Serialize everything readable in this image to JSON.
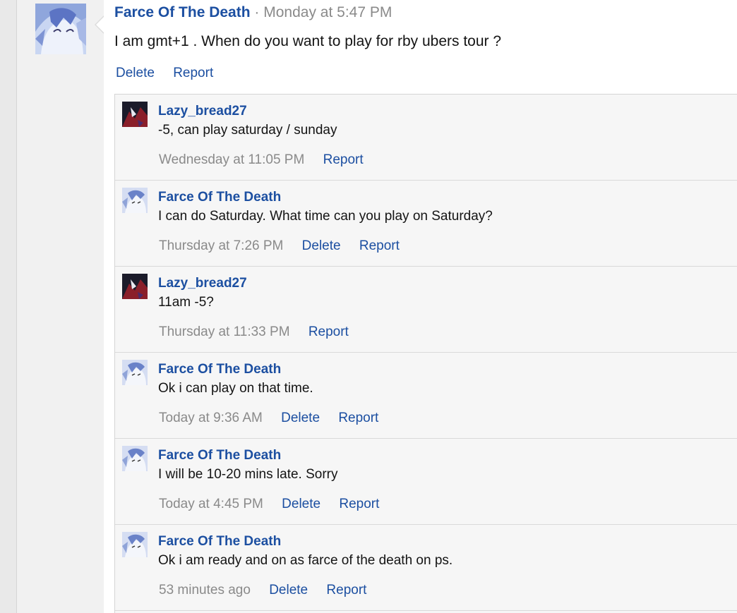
{
  "main_post": {
    "author": "Farce Of The Death",
    "separator": "·",
    "timestamp": "Monday at 5:47 PM",
    "message": "I am gmt+1 . When do you want to play for rby ubers tour ?",
    "actions": {
      "delete": "Delete",
      "report": "Report"
    }
  },
  "comments": [
    {
      "author": "Lazy_bread27",
      "text": "-5, can play saturday / sunday",
      "time": "Wednesday at 11:05 PM",
      "delete": "",
      "report": "Report",
      "avatar": "dark"
    },
    {
      "author": "Farce Of The Death",
      "text": "I can do Saturday. What time can you play on Saturday?",
      "time": "Thursday at 7:26 PM",
      "delete": "Delete",
      "report": "Report",
      "avatar": "light"
    },
    {
      "author": "Lazy_bread27",
      "text": "11am -5?",
      "time": "Thursday at 11:33 PM",
      "delete": "",
      "report": "Report",
      "avatar": "dark"
    },
    {
      "author": "Farce Of The Death",
      "text": "Ok i can play on that time.",
      "time": "Today at 9:36 AM",
      "delete": "Delete",
      "report": "Report",
      "avatar": "light"
    },
    {
      "author": "Farce Of The Death",
      "text": "I will be 10-20 mins late. Sorry",
      "time": "Today at 4:45 PM",
      "delete": "Delete",
      "report": "Report",
      "avatar": "light"
    },
    {
      "author": "Farce Of The Death",
      "text": "Ok i am ready and on as farce of the death on ps.",
      "time": "53 minutes ago",
      "delete": "Delete",
      "report": "Report",
      "avatar": "light"
    }
  ],
  "colors": {
    "link": "#1c4fa1",
    "muted": "#8a8a8a",
    "text": "#141414",
    "comment_bg": "#f6f6f6"
  }
}
